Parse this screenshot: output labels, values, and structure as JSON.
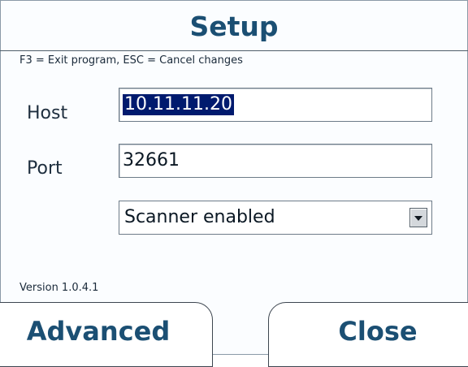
{
  "window": {
    "title": "Setup",
    "hint": "F3 = Exit program, ESC = Cancel changes"
  },
  "form": {
    "host_label": "Host",
    "host_value": "10.11.11.20",
    "port_label": "Port",
    "port_value": "32661",
    "scanner_select_value": "Scanner enabled"
  },
  "footer": {
    "version": "Version 1.0.4.1",
    "advanced_label": "Advanced",
    "close_label": "Close"
  },
  "colors": {
    "title": "#1b4f73",
    "selection": "#001a6e"
  },
  "icons": {
    "dropdown": "chevron-down-icon"
  }
}
